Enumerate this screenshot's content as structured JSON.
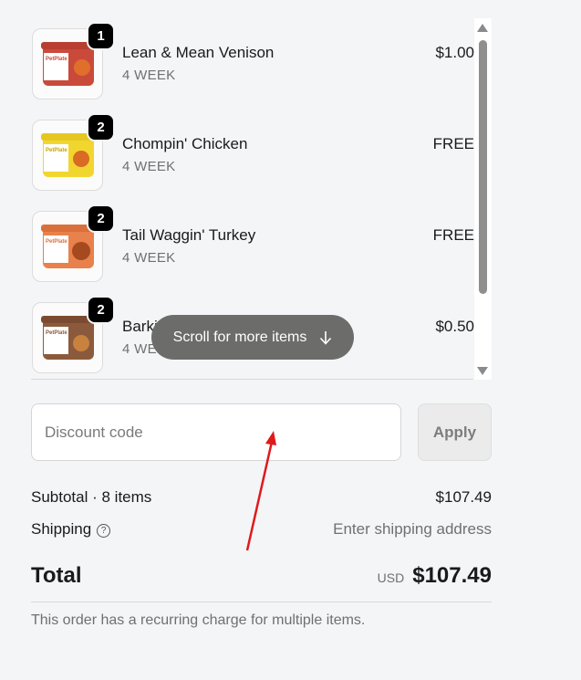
{
  "items": [
    {
      "qty": "1",
      "name": "Lean & Mean Venison",
      "plan": "4 WEEK",
      "price": "$1.00",
      "tub_color": "#c94a3b",
      "label_color": "#ffffff",
      "image_text": "PetPlate Lean & Mean Venison Entrée"
    },
    {
      "qty": "2",
      "name": "Chompin' Chicken",
      "plan": "4 WEEK",
      "price": "FREE",
      "tub_color": "#f2d630",
      "label_color": "#ffffff",
      "image_text": "PetPlate Chompin' Chicken Entrée"
    },
    {
      "qty": "2",
      "name": "Tail Waggin' Turkey",
      "plan": "4 WEEK",
      "price": "FREE",
      "tub_color": "#e8814b",
      "label_color": "#ffffff",
      "image_text": "PetPlate Tail Waggin' Turkey Entrée"
    },
    {
      "qty": "2",
      "name": "Barkin' Beef",
      "plan": "4 WEEK",
      "price": "$0.50",
      "tub_color": "#8b5a3c",
      "label_color": "#ffffff",
      "image_text": "PetPlate Barkin' Beef Entrée"
    }
  ],
  "scroll_hint": {
    "label": "Scroll for more items",
    "icon": "arrow-down-icon"
  },
  "discount": {
    "placeholder": "Discount code",
    "value": "",
    "apply_label": "Apply"
  },
  "summary": {
    "subtotal_label": "Subtotal · 8 items",
    "subtotal_value": "$107.49",
    "shipping_label": "Shipping",
    "shipping_help_icon": "question-circle-icon",
    "shipping_value": "Enter shipping address",
    "total_label": "Total",
    "currency": "USD",
    "total_value": "$107.49"
  },
  "note": "This order has a recurring charge for multiple items.",
  "annotation": {
    "color": "#e0191b",
    "icon": "red-arrow-annotation"
  }
}
